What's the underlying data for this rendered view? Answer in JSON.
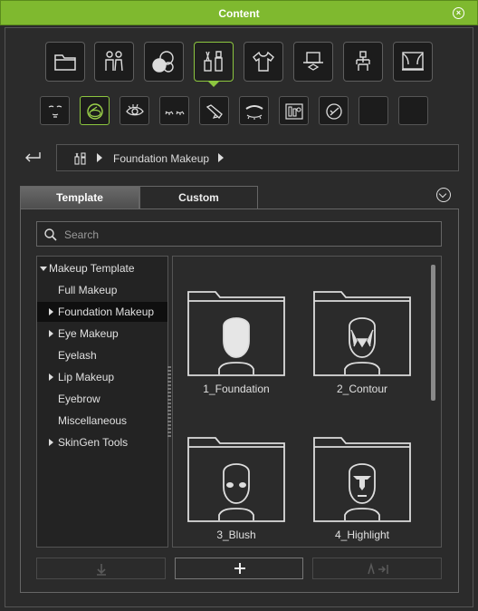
{
  "window": {
    "title": "Content"
  },
  "category_icons": [
    {
      "name": "folder-icon"
    },
    {
      "name": "people-icon"
    },
    {
      "name": "materials-icon"
    },
    {
      "name": "makeup-icon",
      "active": true
    },
    {
      "name": "clothing-icon"
    },
    {
      "name": "hat-icon"
    },
    {
      "name": "stage-icon"
    },
    {
      "name": "theater-icon"
    }
  ],
  "subcategory_icons": [
    {
      "name": "face-icon"
    },
    {
      "name": "foundation-icon",
      "active": true
    },
    {
      "name": "eye-icon"
    },
    {
      "name": "eyelash-icon"
    },
    {
      "name": "lipstick-icon"
    },
    {
      "name": "eyebrow-icon"
    },
    {
      "name": "cosmetics-icon"
    },
    {
      "name": "skingen-icon"
    },
    {
      "name": "empty-slot-icon"
    },
    {
      "name": "empty-slot-icon"
    }
  ],
  "breadcrumb": {
    "path": "Foundation Makeup"
  },
  "tabs": [
    {
      "label": "Template",
      "active": true
    },
    {
      "label": "Custom",
      "active": false
    }
  ],
  "search": {
    "placeholder": "Search",
    "value": ""
  },
  "tree": {
    "root": "Makeup Template",
    "items": [
      {
        "label": "Full Makeup",
        "expandable": false
      },
      {
        "label": "Foundation Makeup",
        "expandable": true,
        "selected": true
      },
      {
        "label": "Eye Makeup",
        "expandable": true
      },
      {
        "label": "Eyelash",
        "expandable": false
      },
      {
        "label": "Lip Makeup",
        "expandable": true
      },
      {
        "label": "Eyebrow",
        "expandable": false
      },
      {
        "label": "Miscellaneous",
        "expandable": false
      },
      {
        "label": "SkinGen Tools",
        "expandable": true
      }
    ]
  },
  "thumbnails": [
    {
      "label": "1_Foundation"
    },
    {
      "label": "2_Contour"
    },
    {
      "label": "3_Blush"
    },
    {
      "label": "4_Highlight"
    }
  ],
  "bottom_buttons": [
    {
      "name": "download-icon",
      "enabled": false
    },
    {
      "name": "add-icon",
      "enabled": true
    },
    {
      "name": "apply-icon",
      "enabled": false
    }
  ],
  "colors": {
    "accent": "#8cc63f",
    "titlebar": "#7fb92f",
    "background": "#2b2b2b"
  }
}
